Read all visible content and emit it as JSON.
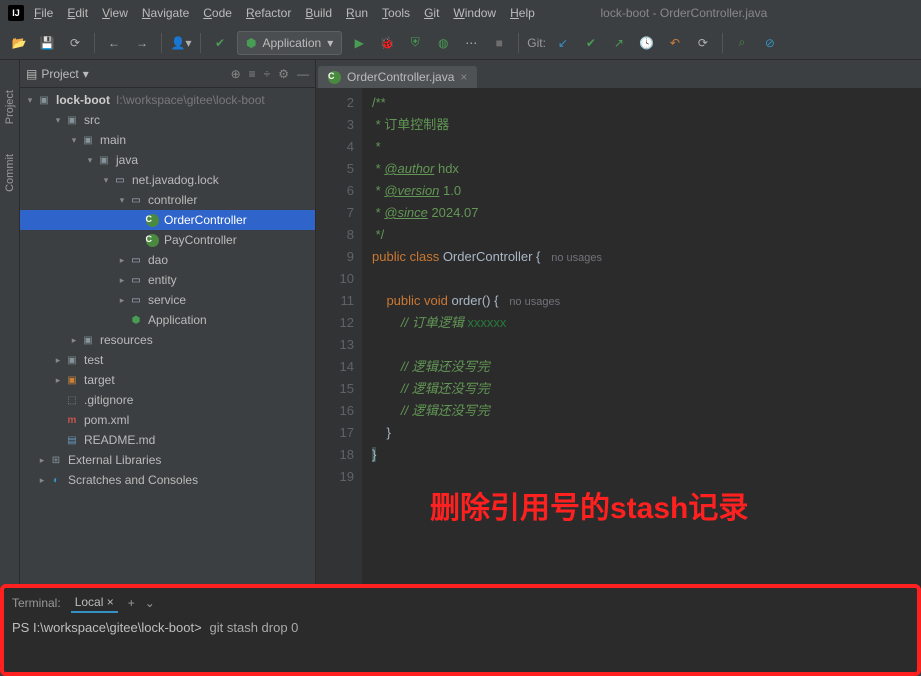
{
  "window": {
    "title": "lock-boot - OrderController.java"
  },
  "menu": [
    "File",
    "Edit",
    "View",
    "Navigate",
    "Code",
    "Refactor",
    "Build",
    "Run",
    "Tools",
    "Git",
    "Window",
    "Help"
  ],
  "runConfig": "Application",
  "gitLabel": "Git:",
  "sidebar": {
    "title": "Project",
    "left_tabs": [
      "Project",
      "Commit"
    ],
    "root": {
      "name": "lock-boot",
      "path": "I:\\workspace\\gitee\\lock-boot"
    },
    "nodes": [
      {
        "indent": 1,
        "arrow": "down",
        "icon": "folder",
        "label": "src"
      },
      {
        "indent": 2,
        "arrow": "down",
        "icon": "folder",
        "label": "main"
      },
      {
        "indent": 3,
        "arrow": "down",
        "icon": "folder",
        "label": "java"
      },
      {
        "indent": 4,
        "arrow": "down",
        "icon": "pkg",
        "label": "net.javadog.lock"
      },
      {
        "indent": 5,
        "arrow": "down",
        "icon": "pkg",
        "label": "controller"
      },
      {
        "indent": 6,
        "arrow": "",
        "icon": "class",
        "label": "OrderController",
        "selected": true
      },
      {
        "indent": 6,
        "arrow": "",
        "icon": "class",
        "label": "PayController"
      },
      {
        "indent": 5,
        "arrow": "right",
        "icon": "pkg",
        "label": "dao"
      },
      {
        "indent": 5,
        "arrow": "right",
        "icon": "pkg",
        "label": "entity"
      },
      {
        "indent": 5,
        "arrow": "right",
        "icon": "pkg",
        "label": "service"
      },
      {
        "indent": 5,
        "arrow": "",
        "icon": "app",
        "label": "Application"
      },
      {
        "indent": 2,
        "arrow": "right",
        "icon": "folder",
        "label": "resources"
      },
      {
        "indent": 1,
        "arrow": "right",
        "icon": "folder",
        "label": "test"
      },
      {
        "indent": 1,
        "arrow": "right",
        "icon": "folder-orange",
        "label": "target"
      },
      {
        "indent": 1,
        "arrow": "",
        "icon": "file",
        "label": ".gitignore"
      },
      {
        "indent": 1,
        "arrow": "",
        "icon": "maven",
        "label": "pom.xml"
      },
      {
        "indent": 1,
        "arrow": "",
        "icon": "md",
        "label": "README.md"
      },
      {
        "indent": 0,
        "arrow": "right",
        "icon": "lib",
        "label": "External Libraries"
      },
      {
        "indent": 0,
        "arrow": "right",
        "icon": "scratch",
        "label": "Scratches and Consoles"
      }
    ]
  },
  "editor": {
    "tab": "OrderController.java",
    "lines": [
      {
        "n": 2,
        "html": "<span class='c-doc'>/**</span>"
      },
      {
        "n": 3,
        "html": "<span class='c-doc'> * 订单控制器</span>"
      },
      {
        "n": 4,
        "html": "<span class='c-doc'> *</span>"
      },
      {
        "n": 5,
        "html": "<span class='c-doc'> * <span class='c-tag'>@author</span> hdx</span>"
      },
      {
        "n": 6,
        "html": "<span class='c-doc'> * <span class='c-tag'>@version</span> 1.0</span>"
      },
      {
        "n": 7,
        "html": "<span class='c-doc'> * <span class='c-tag'>@since</span> 2024.07</span>"
      },
      {
        "n": 8,
        "html": "<span class='c-doc'> */</span>"
      },
      {
        "n": 9,
        "html": "<span class='c-kw'>public class </span><span class='c-cls'>OrderController </span><span class='c-brace'>{</span>   <span class='hint'>no usages</span>"
      },
      {
        "n": 10,
        "html": ""
      },
      {
        "n": 11,
        "html": "    <span class='c-kw'>public void </span><span class='c-cls'>order() </span><span class='c-brace'>{</span>   <span class='hint'>no usages</span>"
      },
      {
        "n": 12,
        "html": "        <span class='c-comment'>// 订单逻辑 </span><span class='c-str'>xxxxxx</span>"
      },
      {
        "n": 13,
        "html": ""
      },
      {
        "n": 14,
        "html": "        <span class='c-comment'>// 逻辑还没写完</span>"
      },
      {
        "n": 15,
        "html": "        <span class='c-comment'>// 逻辑还没写完</span>"
      },
      {
        "n": 16,
        "html": "        <span class='c-comment'>// 逻辑还没写完</span>"
      },
      {
        "n": 17,
        "html": "    <span class='c-brace'>}</span>"
      },
      {
        "n": 18,
        "html": "<span class='c-brace' style='background:#3b514d'>}</span>"
      },
      {
        "n": 19,
        "html": ""
      }
    ]
  },
  "annotation": "删除引用号的stash记录",
  "terminal": {
    "title": "Terminal:",
    "tab": "Local",
    "prompt": "PS I:\\workspace\\gitee\\lock-boot>",
    "command": "git stash drop 0"
  }
}
